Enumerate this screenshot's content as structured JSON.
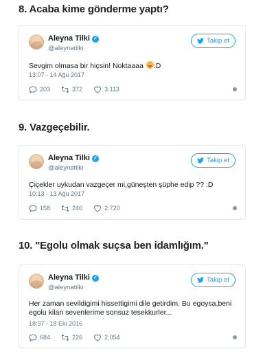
{
  "colors": {
    "accent": "#1da1f2",
    "muted": "#657786",
    "border": "#e1e8ed"
  },
  "sections": [
    {
      "heading": "8. Acaba kime gönderme yaptı?",
      "tweet": {
        "name": "Aleyna Tilki",
        "handle": "@aleynatilki",
        "follow_label": "Takip et",
        "text_before_emoji": "Sevgim olmasa bir hiçsin! Noktaaaa ",
        "emoji": "face-with-tongue-emoji",
        "text_after_emoji": ":D",
        "timestamp": "13:07 - 14 Ağu 2017",
        "replies": "203",
        "retweets": "372",
        "likes": "3.113"
      }
    },
    {
      "heading": "9. Vazgeçebilir.",
      "tweet": {
        "name": "Aleyna Tilki",
        "handle": "@aleynatilki",
        "follow_label": "Takip et",
        "text": "Çiçekler uykudan vazgeçer mi,güneşten şüphe edip ?? :D",
        "timestamp": "10:13 - 13 Ağu 2017",
        "replies": "158",
        "retweets": "240",
        "likes": "2.720"
      }
    },
    {
      "heading": "10. \"Egolu olmak suçsa ben idamlığım.\"",
      "tweet": {
        "name": "Aleyna Tilki",
        "handle": "@aleynatilki",
        "follow_label": "Takip et",
        "text": "Her zaman sevildigimi hissettigimi dile getirdim. Bu egoysa,beni egolu kilan sevenlerime sonsuz tesekkurler...",
        "timestamp": "18:37 - 18 Eki 2016",
        "replies": "684",
        "retweets": "226",
        "likes": "2.054"
      }
    }
  ]
}
